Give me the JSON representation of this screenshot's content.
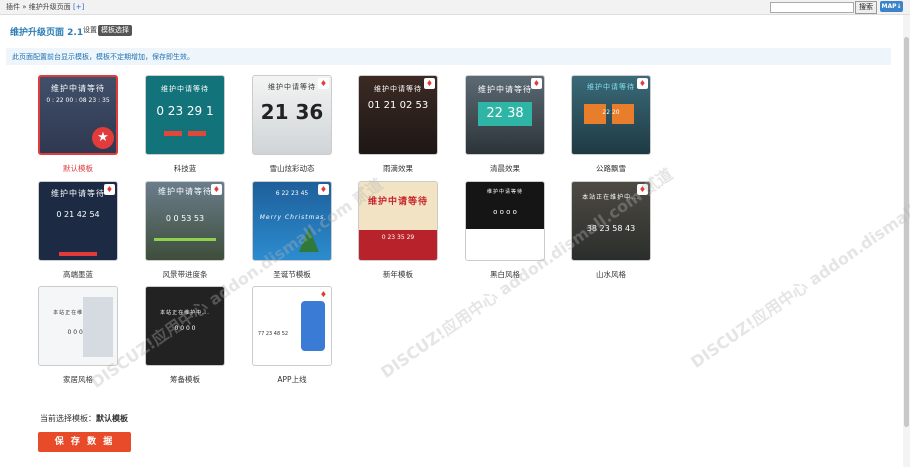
{
  "topbar": {
    "crumb_plugin": "插件",
    "crumb_sep": "»",
    "crumb_page": "维护升级页面",
    "crumb_plus": "[+]",
    "search_button": "搜索",
    "map_button": "MAP"
  },
  "header": {
    "title": "维护升级页面 2.1",
    "tab_settings": "设置",
    "tab_template": "模板选择"
  },
  "notice": "此页面配置前台显示模板，模板不定期增加，保存即生效。",
  "templates": [
    {
      "name": "默认模板",
      "thumb_title": "维护中请等待",
      "thumb_nums": "0 : 22  00 : 08  23 : 35",
      "selected": true
    },
    {
      "name": "科技蓝",
      "thumb_title": "维护中请等待",
      "thumb_nums": "0  23  29  1"
    },
    {
      "name": "雪山炫彩动态",
      "thumb_title": "维护中请等待",
      "thumb_nums": "21  36"
    },
    {
      "name": "雨滴效果",
      "thumb_title": "维护中请等待",
      "thumb_nums": "01  21  02  53"
    },
    {
      "name": "清晨效果",
      "thumb_title": "维护中请等待",
      "thumb_nums": "22  38"
    },
    {
      "name": "公路飘雪",
      "thumb_title": "维护中请等待",
      "thumb_nums": "22  20"
    },
    {
      "name": "高端墨蓝",
      "thumb_title": "维护中请等待",
      "thumb_nums": "0  21  42  54"
    },
    {
      "name": "风景带进度条",
      "thumb_title": "维护中请等待",
      "thumb_nums": "0  0  53  53"
    },
    {
      "name": "圣诞节模板",
      "thumb_title": "Merry Christmas",
      "thumb_nums": "6  22  23  45"
    },
    {
      "name": "新年模板",
      "thumb_title": "维护中请等待",
      "thumb_nums": "0  23  35  29"
    },
    {
      "name": "黑白风格",
      "thumb_title": "维护中请等待",
      "thumb_nums": "o  o  o  o"
    },
    {
      "name": "山水风格",
      "thumb_title": "本站正在维护中...",
      "thumb_nums": "38  23  58  43"
    },
    {
      "name": "家居风格",
      "thumb_title": "本站正在维护中...",
      "thumb_nums": "0  0  0  0"
    },
    {
      "name": "筹备模板",
      "thumb_title": "本站正在维护中...",
      "thumb_nums": "0  0  0  0"
    },
    {
      "name": "APP上线",
      "thumb_title": "",
      "thumb_nums": "77  23  48  52"
    }
  ],
  "current_label": "当前选择模板：",
  "current_value": "默认模板",
  "save_button": "保 存 数 据",
  "watermark": "DISCUZ!应用中心 addon.dismall.com 贰道"
}
